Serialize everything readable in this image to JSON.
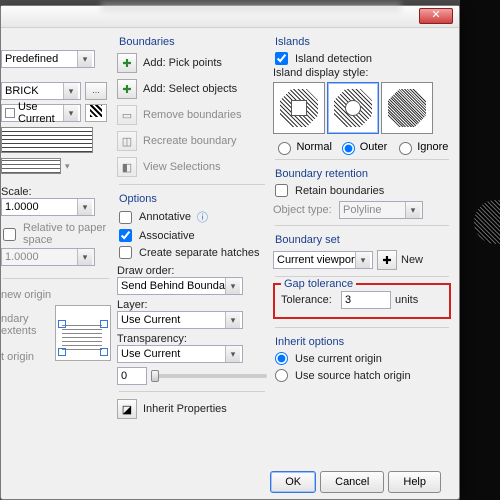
{
  "titlebar": {
    "close": "✕"
  },
  "left": {
    "type_label": "Predefined",
    "pattern": "BRICK",
    "ellipsis": "...",
    "color_mode": "Use Current",
    "scale_label": "Scale:",
    "scale_value": "1.0000",
    "relative": "Relative to paper space",
    "spacing_value": "1.0000",
    "origin_new": "new origin",
    "origin_extents": "ndary extents",
    "origin_set": "t origin"
  },
  "boundaries": {
    "title": "Boundaries",
    "add_pick": "Add: Pick points",
    "add_select": "Add: Select objects",
    "remove": "Remove boundaries",
    "recreate": "Recreate boundary",
    "view_sel": "View Selections"
  },
  "options": {
    "title": "Options",
    "annotative": "Annotative",
    "associative": "Associative",
    "separate": "Create separate hatches",
    "draw_order_label": "Draw order:",
    "draw_order": "Send Behind Boundary",
    "layer_label": "Layer:",
    "layer": "Use Current",
    "transparency_label": "Transparency:",
    "transparency": "Use Current",
    "transp_val": "0",
    "inherit": "Inherit Properties"
  },
  "islands": {
    "title": "Islands",
    "detect": "Island detection",
    "style_label": "Island display style:",
    "normal": "Normal",
    "outer": "Outer",
    "ignore": "Ignore"
  },
  "retention": {
    "title": "Boundary retention",
    "retain": "Retain boundaries",
    "objtype_label": "Object type:",
    "objtype": "Polyline"
  },
  "bset": {
    "title": "Boundary set",
    "set": "Current viewport",
    "new": "New"
  },
  "gap": {
    "title": "Gap tolerance",
    "tol_label": "Tolerance:",
    "tol_val": "3",
    "units": "units"
  },
  "inherit": {
    "title": "Inherit options",
    "current": "Use current origin",
    "source": "Use source hatch origin"
  },
  "buttons": {
    "ok": "OK",
    "cancel": "Cancel",
    "help": "Help"
  }
}
